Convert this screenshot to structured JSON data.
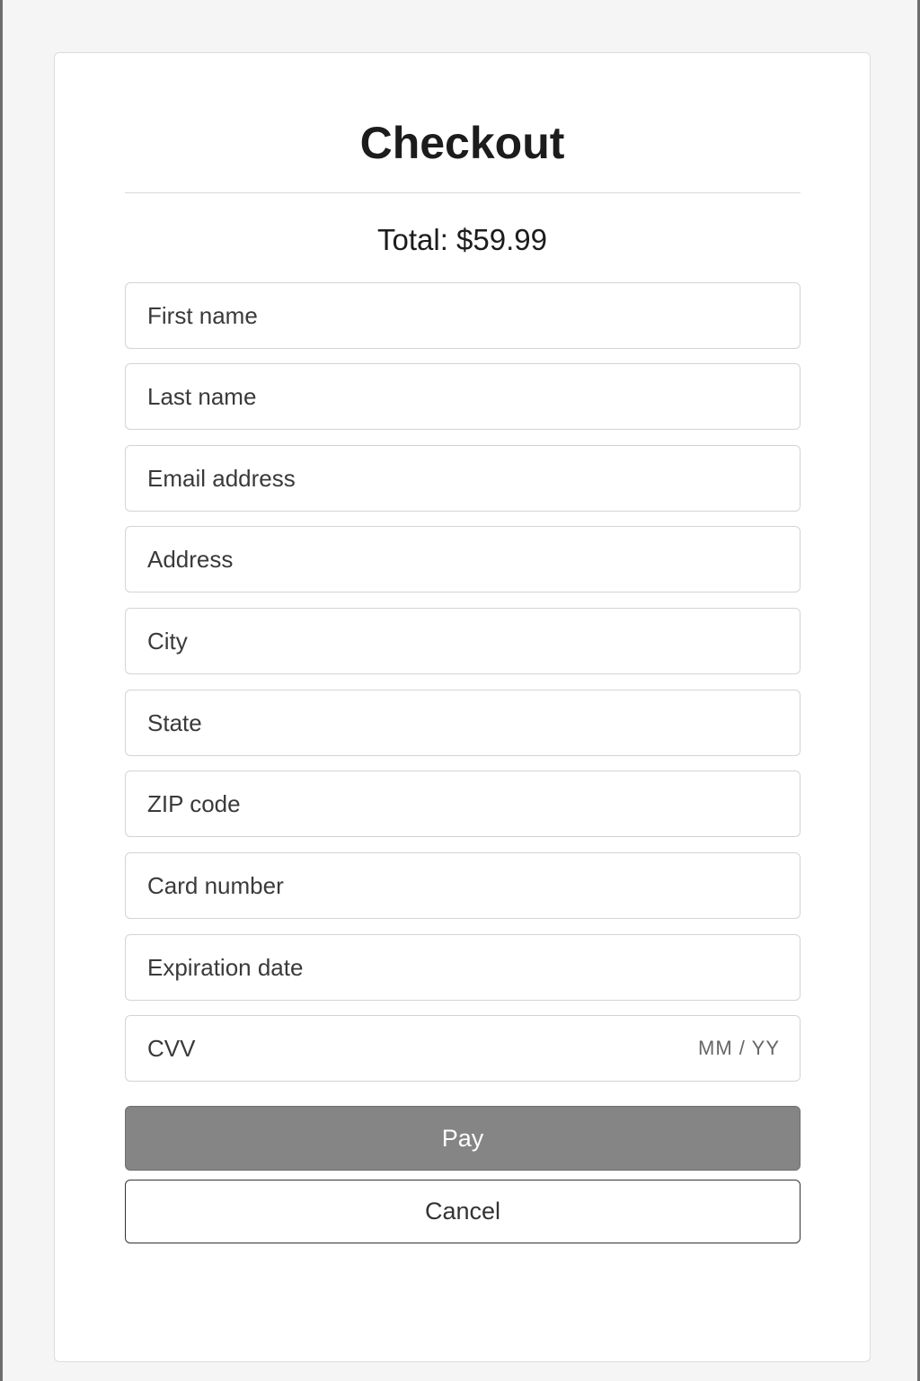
{
  "checkout": {
    "title": "Checkout",
    "total": "Total: $59.99",
    "fields": [
      {
        "placeholder": "First name"
      },
      {
        "placeholder": "Last name"
      },
      {
        "placeholder": "Email address"
      },
      {
        "placeholder": "Address"
      },
      {
        "placeholder": "City"
      },
      {
        "placeholder": "State"
      },
      {
        "placeholder": "ZIP code"
      },
      {
        "placeholder": "Card number"
      },
      {
        "placeholder": "Expiration date"
      },
      {
        "placeholder": "CVV",
        "hint": "MM / YY"
      }
    ],
    "pay_label": "Pay",
    "cancel_label": "Cancel"
  },
  "colors": {
    "page_background": "#f5f5f5",
    "card_background": "#ffffff",
    "pay_button": "#858585",
    "border": "#d4d4d4"
  }
}
